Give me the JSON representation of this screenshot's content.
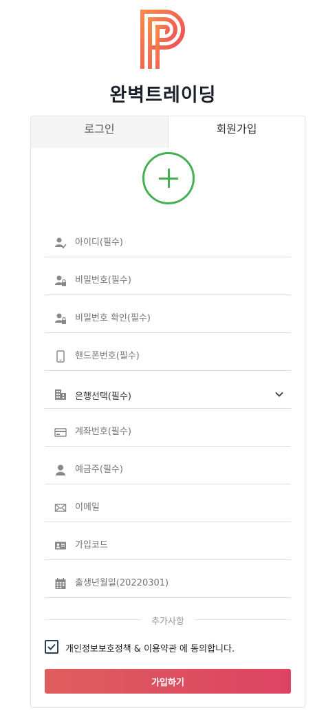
{
  "brand": {
    "name": "완벽트레이딩",
    "logo_icon": "p-logo-icon",
    "logo_colors": [
      "#f7894a",
      "#e9455a"
    ]
  },
  "tabs": [
    {
      "label": "로그인",
      "active": false
    },
    {
      "label": "회원가입",
      "active": true
    }
  ],
  "avatar_upload": {
    "icon": "plus-icon",
    "color": "#45b04f"
  },
  "fields": {
    "user_id": {
      "placeholder": "아이디(필수)",
      "icon": "user-check-icon"
    },
    "password": {
      "placeholder": "비밀번호(필수)",
      "icon": "user-lock-icon"
    },
    "password_confirm": {
      "placeholder": "비밀번호 확인(필수)",
      "icon": "user-lock-icon"
    },
    "phone": {
      "placeholder": "핸드폰번호(필수)",
      "icon": "phone-icon"
    },
    "bank": {
      "value": "은행선택(필수)",
      "icon": "building-icon",
      "chevron": "chevron-down-icon"
    },
    "account": {
      "placeholder": "계좌번호(필수)",
      "icon": "card-icon"
    },
    "holder": {
      "placeholder": "예금주(필수)",
      "icon": "user-icon"
    },
    "email": {
      "placeholder": "이메일",
      "icon": "mail-icon"
    },
    "signup_code": {
      "placeholder": "가입코드",
      "icon": "id-card-icon"
    },
    "birth": {
      "placeholder": "출생년월일(20220301)",
      "icon": "calendar-icon"
    }
  },
  "divider_label": "추가사항",
  "agreement": {
    "checked": true,
    "text": "개인정보보호정책 & 이용약관 에 동의합니다."
  },
  "submit_label": "가입하기",
  "colors": {
    "accent_green": "#45b04f",
    "button_start": "#de5e5e",
    "button_end": "#dc4363"
  }
}
